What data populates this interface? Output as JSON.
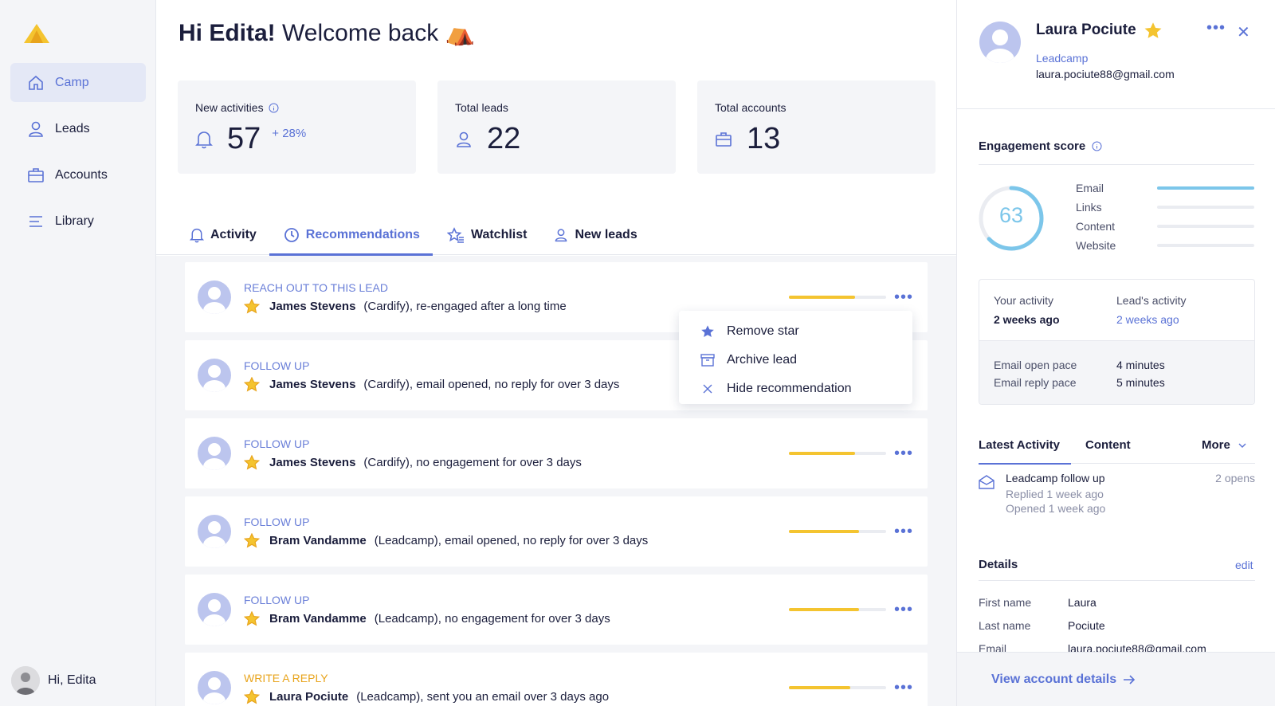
{
  "sidebar": {
    "items": [
      {
        "label": "Camp",
        "icon": "home-icon",
        "active": true
      },
      {
        "label": "Leads",
        "icon": "user-icon",
        "active": false
      },
      {
        "label": "Accounts",
        "icon": "briefcase-icon",
        "active": false
      },
      {
        "label": "Library",
        "icon": "library-icon",
        "active": false
      }
    ],
    "user_label": "Hi, Edita"
  },
  "header": {
    "greeting": "Hi Edita!",
    "subtitle": "Welcome back",
    "emoji": "⛺"
  },
  "stats": {
    "new_activities": {
      "label": "New activities",
      "value": "57",
      "delta": "+ 28%"
    },
    "total_leads": {
      "label": "Total leads",
      "value": "22"
    },
    "total_accounts": {
      "label": "Total accounts",
      "value": "13"
    }
  },
  "tabs": [
    {
      "label": "Activity",
      "icon": "bell-icon"
    },
    {
      "label": "Recommendations",
      "icon": "clock-icon",
      "active": true
    },
    {
      "label": "Watchlist",
      "icon": "star-list-icon"
    },
    {
      "label": "New leads",
      "icon": "user-icon"
    }
  ],
  "recommendations": [
    {
      "kind": "REACH OUT TO THIS LEAD",
      "kind_color": "#6a7fd8",
      "name": "James Stevens",
      "desc": "(Cardify), re-engaged after a long time",
      "score": 0.68
    },
    {
      "kind": "FOLLOW UP",
      "kind_color": "#6a7fd8",
      "name": "James Stevens",
      "desc": "(Cardify), email opened, no reply for over 3 days",
      "score": 0.68
    },
    {
      "kind": "FOLLOW UP",
      "kind_color": "#6a7fd8",
      "name": "James Stevens",
      "desc": "(Cardify), no engagement for over 3 days",
      "score": 0.68
    },
    {
      "kind": "FOLLOW UP",
      "kind_color": "#6a7fd8",
      "name": "Bram Vandamme",
      "desc": "(Leadcamp), email opened, no reply for over 3 days",
      "score": 0.72
    },
    {
      "kind": "FOLLOW UP",
      "kind_color": "#6a7fd8",
      "name": "Bram Vandamme",
      "desc": "(Leadcamp), no engagement for over 3 days",
      "score": 0.72
    },
    {
      "kind": "WRITE A REPLY",
      "kind_color": "#e8a41c",
      "name": "Laura Pociute",
      "desc": "(Leadcamp), sent you an email over 3 days ago",
      "score": 0.63
    }
  ],
  "context_menu": {
    "items": [
      {
        "label": "Remove star",
        "icon": "star-icon"
      },
      {
        "label": "Archive lead",
        "icon": "archive-icon"
      },
      {
        "label": "Hide recommendation",
        "icon": "close-icon"
      }
    ]
  },
  "panel": {
    "name": "Laura Pociute",
    "company": "Leadcamp",
    "email": "laura.pociute88@gmail.com",
    "engagement": {
      "title": "Engagement score",
      "score": "63",
      "score_fraction": 0.63,
      "rows": [
        {
          "label": "Email",
          "level": 1.0
        },
        {
          "label": "Links",
          "level": 0.0
        },
        {
          "label": "Content",
          "level": 0.0
        },
        {
          "label": "Website",
          "level": 0.0
        }
      ]
    },
    "activity": {
      "your_label": "Your activity",
      "your_value": "2 weeks ago",
      "lead_label": "Lead's activity",
      "lead_value": "2 weeks ago",
      "open_pace_label": "Email open pace",
      "open_pace_value": "4 minutes",
      "reply_pace_label": "Email reply pace",
      "reply_pace_value": "5 minutes"
    },
    "tabs": {
      "latest": "Latest Activity",
      "content": "Content",
      "more": "More"
    },
    "latest": {
      "title": "Leadcamp follow up",
      "opens": "2 opens",
      "replied": "Replied 1 week ago",
      "opened": "Opened 1 week ago"
    },
    "details": {
      "title": "Details",
      "edit": "edit",
      "rows": [
        {
          "k": "First name",
          "v": "Laura"
        },
        {
          "k": "Last name",
          "v": "Pociute"
        },
        {
          "k": "Email",
          "v": "laura.pociute88@gmail.com"
        }
      ]
    },
    "footer_link": "View account details"
  },
  "colors": {
    "accent": "#5a72d6",
    "star": "#f4c430",
    "gauge": "#7cc6ea",
    "reply_kind": "#e8a41c"
  }
}
